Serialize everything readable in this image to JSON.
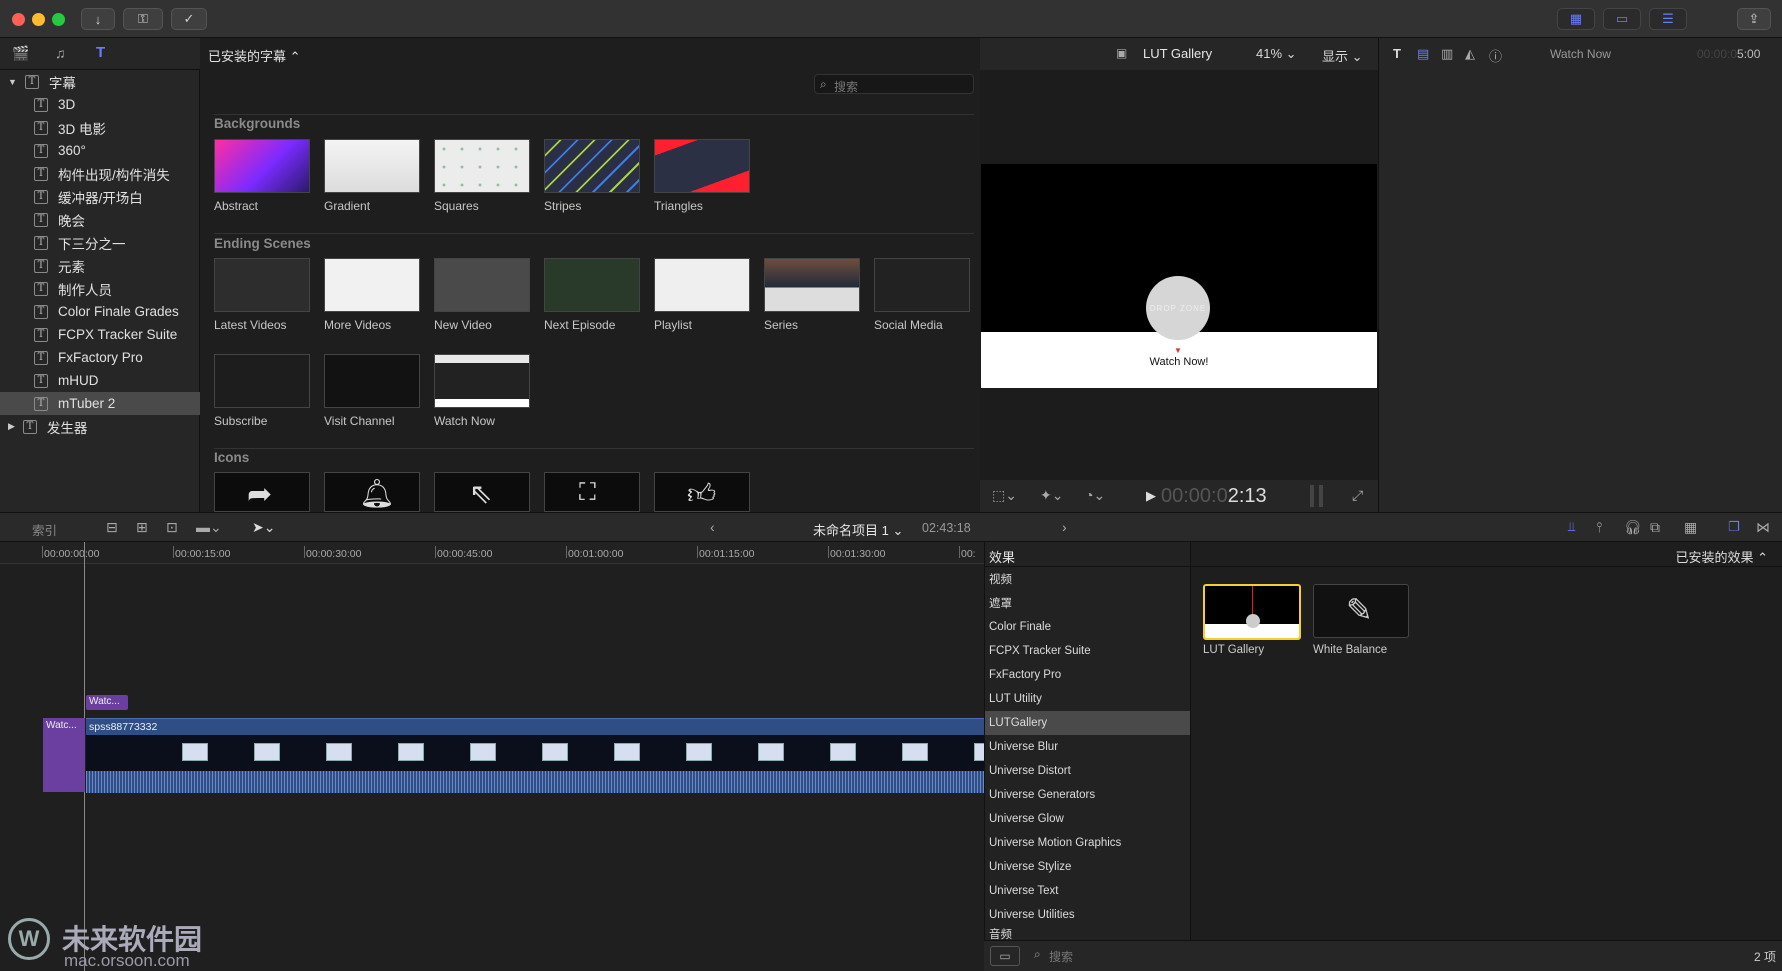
{
  "toolbar": {
    "icons": [
      "import-icon",
      "key-icon",
      "checkmark-icon",
      "browser-view-icon",
      "timeline-view-icon",
      "inspector-view-icon",
      "share-icon"
    ]
  },
  "browser": {
    "library_title": "已安装的字幕",
    "search_placeholder": "搜索",
    "sidebar": [
      {
        "label": "字幕",
        "level": 0,
        "expanded": true
      },
      {
        "label": "3D",
        "level": 1
      },
      {
        "label": "3D 电影",
        "level": 1
      },
      {
        "label": "360°",
        "level": 1
      },
      {
        "label": "构件出现/构件消失",
        "level": 1
      },
      {
        "label": "缓冲器/开场白",
        "level": 1
      },
      {
        "label": "晚会",
        "level": 1
      },
      {
        "label": "下三分之一",
        "level": 1
      },
      {
        "label": "元素",
        "level": 1
      },
      {
        "label": "制作人员",
        "level": 1
      },
      {
        "label": "Color Finale Grades",
        "level": 1
      },
      {
        "label": "FCPX Tracker Suite",
        "level": 1
      },
      {
        "label": "FxFactory Pro",
        "level": 1
      },
      {
        "label": "mHUD",
        "level": 1
      },
      {
        "label": "mTuber 2",
        "level": 1,
        "selected": true
      },
      {
        "label": "发生器",
        "level": 0,
        "expanded": false
      }
    ],
    "sections": [
      {
        "title": "Backgrounds",
        "items": [
          "Abstract",
          "Gradient",
          "Squares",
          "Stripes",
          "Triangles"
        ]
      },
      {
        "title": "Ending Scenes",
        "items": [
          "Latest Videos",
          "More Videos",
          "New Video",
          "Next Episode",
          "Playlist",
          "Series",
          "Social Media",
          "Subscribe",
          "Visit Channel",
          "Watch Now"
        ]
      },
      {
        "title": "Icons",
        "items": []
      }
    ]
  },
  "viewer": {
    "clip_name": "LUT Gallery",
    "zoom": "41%",
    "view_menu": "显示",
    "drop_zone_text": "DROP ZONE",
    "watch_now_text": "Watch Now!",
    "timecode_dim": "00:00:0",
    "timecode_bright": "2:13"
  },
  "inspector": {
    "title": "Watch Now",
    "timecode_dim": "00:00:0",
    "timecode_bright": "5:00"
  },
  "timeline": {
    "index_label": "索引",
    "project_name": "未命名项目 1",
    "duration": "02:43:18",
    "ruler": [
      "00:00:00:00",
      "00:00:15:00",
      "00:00:30:00",
      "00:00:45:00",
      "00:01:00:00",
      "00:01:15:00",
      "00:01:30:00",
      "00:"
    ],
    "title_clip": "Watc...",
    "connected_clip": "Watc...",
    "main_clip": "spss88773332"
  },
  "effects": {
    "header": "效果",
    "filter": "已安装的效果",
    "categories": [
      "视频",
      "遮罩",
      "Color Finale",
      "FCPX Tracker Suite",
      "FxFactory Pro",
      "LUT Utility",
      "LUTGallery",
      "Universe Blur",
      "Universe Distort",
      "Universe Generators",
      "Universe Glow",
      "Universe Motion Graphics",
      "Universe Stylize",
      "Universe Text",
      "Universe Utilities",
      "音频"
    ],
    "selected_category": "LUTGallery",
    "items": [
      "LUT Gallery",
      "White Balance"
    ],
    "search_placeholder": "搜索",
    "count": "2 项"
  },
  "watermark": {
    "brand": "未来软件园",
    "url": "mac.orsoon.com"
  },
  "colors": {
    "accent": "#6c7cff",
    "selection": "#4a4a4a",
    "clip_blue": "#2f4e86",
    "clip_purple": "#6a3fa0",
    "highlight_yellow": "#f2d22a"
  }
}
